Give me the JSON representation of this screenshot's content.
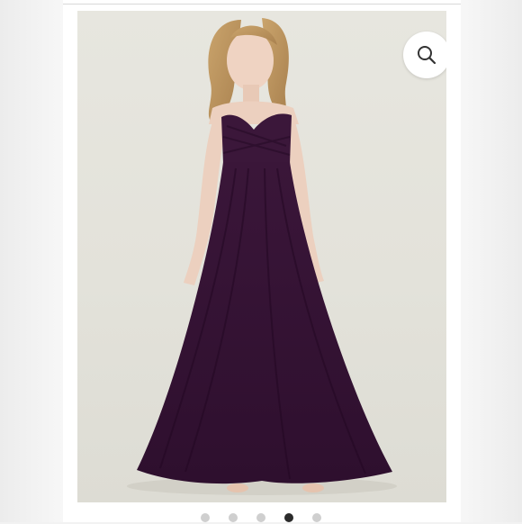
{
  "product_image": {
    "alt": "",
    "dress_color": "#3f1a3f",
    "background_color": "#e5e4dc"
  },
  "zoom": {
    "icon": "magnifier-icon"
  },
  "gallery": {
    "total_images": 5,
    "active_index": 3
  }
}
